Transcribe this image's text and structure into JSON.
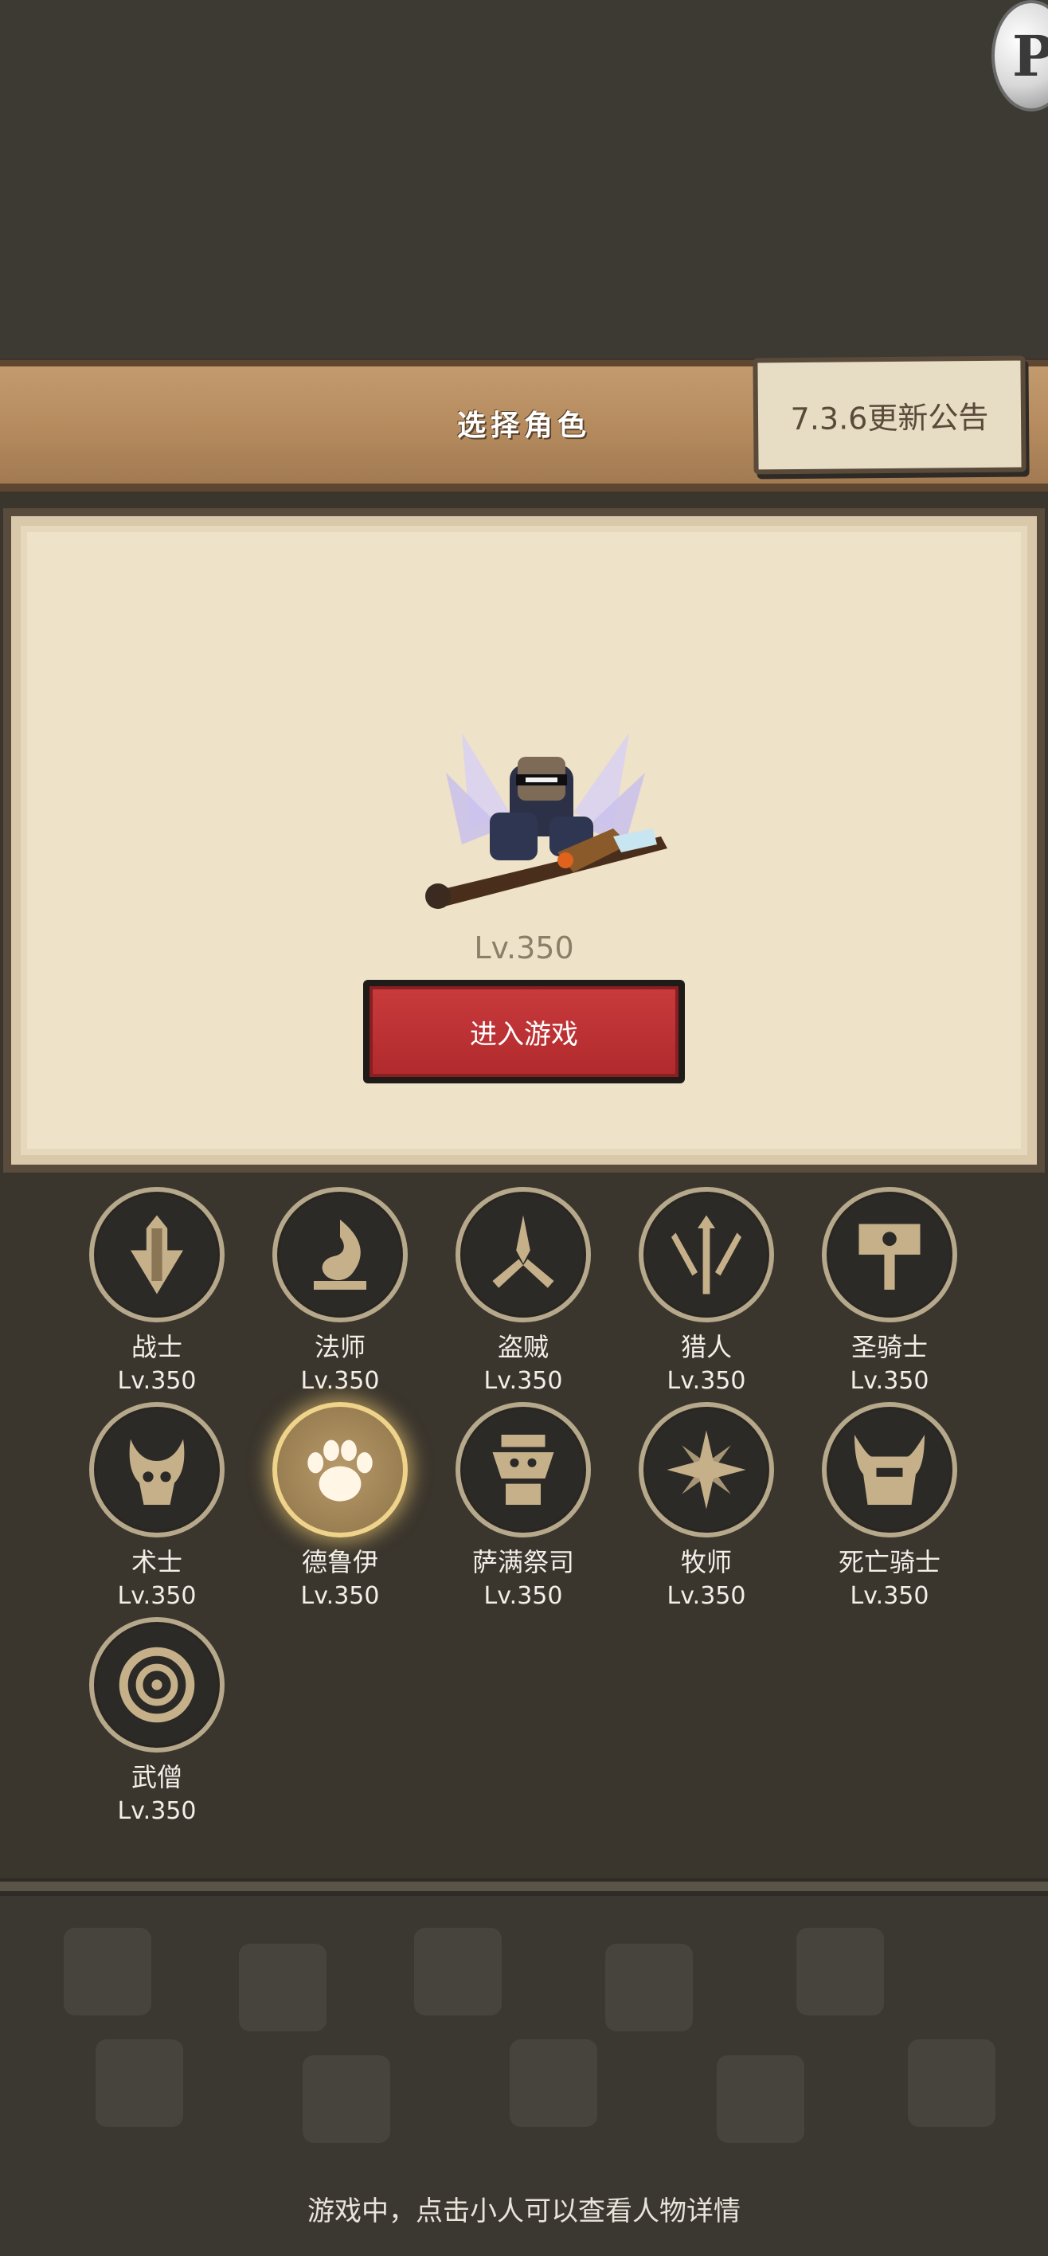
{
  "header": {
    "title": "选择角色",
    "notice_button": "7.3.6更新公告"
  },
  "floating_button": {
    "label": "P"
  },
  "selected_character": {
    "level": "Lv.350",
    "enter_button": "进入游戏"
  },
  "classes": [
    {
      "name": "战士",
      "level": "Lv.350",
      "icon": "sword-shield-icon",
      "selected": false
    },
    {
      "name": "法师",
      "level": "Lv.350",
      "icon": "flame-swirl-icon",
      "selected": false
    },
    {
      "name": "盗贼",
      "level": "Lv.350",
      "icon": "crossed-daggers-icon",
      "selected": false
    },
    {
      "name": "猎人",
      "level": "Lv.350",
      "icon": "arrows-icon",
      "selected": false
    },
    {
      "name": "圣骑士",
      "level": "Lv.350",
      "icon": "hammer-icon",
      "selected": false
    },
    {
      "name": "术士",
      "level": "Lv.350",
      "icon": "demon-skull-icon",
      "selected": false
    },
    {
      "name": "德鲁伊",
      "level": "Lv.350",
      "icon": "paw-icon",
      "selected": true
    },
    {
      "name": "萨满祭司",
      "level": "Lv.350",
      "icon": "totem-icon",
      "selected": false
    },
    {
      "name": "牧师",
      "level": "Lv.350",
      "icon": "star-burst-icon",
      "selected": false
    },
    {
      "name": "死亡骑士",
      "level": "Lv.350",
      "icon": "horned-helm-icon",
      "selected": false
    },
    {
      "name": "武僧",
      "level": "Lv.350",
      "icon": "spiral-icon",
      "selected": false
    }
  ],
  "footer": {
    "hint": "游戏中，点击小人可以查看人物详情"
  },
  "colors": {
    "enter_button": "#b12a2d",
    "selected_glow": "#f0d38a",
    "panel_bg": "#eee2c8"
  }
}
